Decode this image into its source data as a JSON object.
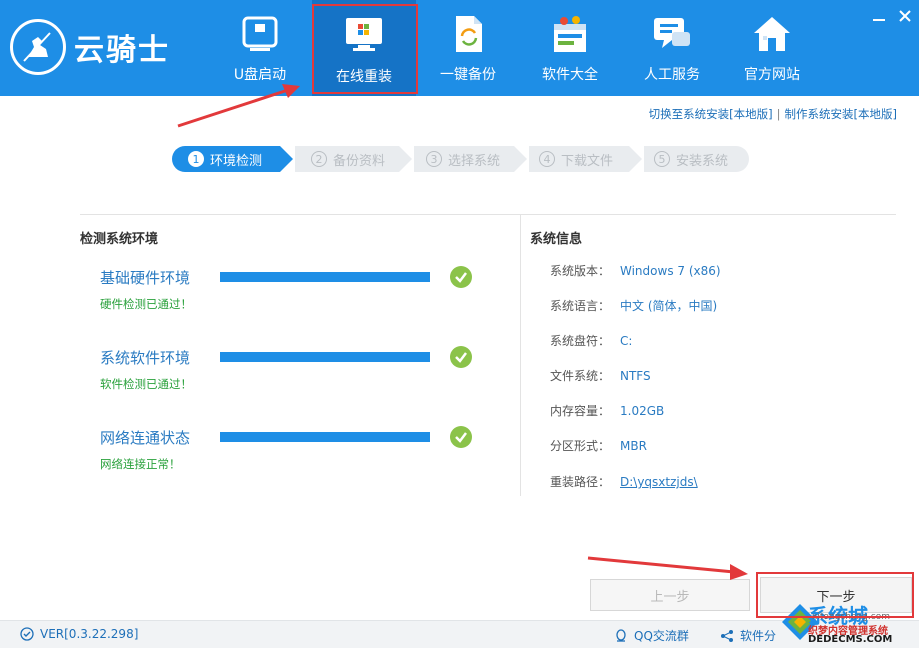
{
  "app": {
    "logo_text": "云骑士",
    "brand_color": "#1e8ee6"
  },
  "nav": [
    {
      "label": "U盘启动",
      "icon": "usb-drive-icon"
    },
    {
      "label": "在线重装",
      "icon": "windows-monitor-icon"
    },
    {
      "label": "一键备份",
      "icon": "backup-document-icon"
    },
    {
      "label": "软件大全",
      "icon": "software-box-icon"
    },
    {
      "label": "人工服务",
      "icon": "chat-service-icon"
    },
    {
      "label": "官方网站",
      "icon": "home-icon"
    }
  ],
  "top_links": {
    "switch_local": "切换至系统安装[本地版]",
    "separator": "|",
    "make_local": "制作系统安装[本地版]"
  },
  "steps": [
    {
      "num": "1",
      "label": "环境检测"
    },
    {
      "num": "2",
      "label": "备份资料"
    },
    {
      "num": "3",
      "label": "选择系统"
    },
    {
      "num": "4",
      "label": "下载文件"
    },
    {
      "num": "5",
      "label": "安装系统"
    }
  ],
  "check": {
    "title": "检测系统环境",
    "items": [
      {
        "label": "基础硬件环境",
        "status": "硬件检测已通过！",
        "progress": 1.0
      },
      {
        "label": "系统软件环境",
        "status": "软件检测已通过！",
        "progress": 1.0
      },
      {
        "label": "网络连通状态",
        "status": "网络连接正常！",
        "progress": 1.0
      }
    ]
  },
  "sysinfo": {
    "title": "系统信息",
    "rows": [
      {
        "key": "系统版本：",
        "value": "Windows 7 (x86)"
      },
      {
        "key": "系统语言：",
        "value": "中文 (简体，中国)"
      },
      {
        "key": "系统盘符：",
        "value": "C:"
      },
      {
        "key": "文件系统：",
        "value": "NTFS"
      },
      {
        "key": "内存容量：",
        "value": "1.02GB"
      },
      {
        "key": "分区形式：",
        "value": "MBR"
      },
      {
        "key": "重装路径：",
        "value": "D:\\yqsxtzjds\\"
      }
    ]
  },
  "buttons": {
    "prev": "上一步",
    "next": "下一步"
  },
  "footer": {
    "version": "VER[0.3.22.298]",
    "qq_group": "QQ交流群",
    "share": "软件分"
  },
  "watermark": {
    "line1": "系统城",
    "line2": "织梦内容管理系统",
    "line3": "DEDECMS.COM",
    "line4": "xitongcheng.com"
  }
}
